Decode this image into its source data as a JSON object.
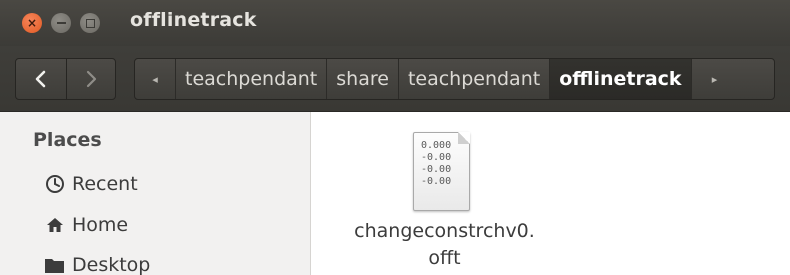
{
  "window": {
    "title": "offlinetrack"
  },
  "toolbar": {
    "back_icon": "chevron-left-icon",
    "forward_icon": "chevron-right-icon",
    "path_left_icon": "path-scroll-left-icon",
    "path_right_icon": "path-scroll-right-icon",
    "breadcrumbs": [
      "teachpendant",
      "share",
      "teachpendant",
      "offlinetrack"
    ]
  },
  "sidebar": {
    "heading": "Places",
    "items": [
      {
        "label": "Recent",
        "icon": "clock-icon"
      },
      {
        "label": "Home",
        "icon": "home-icon"
      },
      {
        "label": "Desktop",
        "icon": "folder-icon"
      }
    ]
  },
  "files": [
    {
      "name": "changeconstrchv0.\nofft",
      "icon": "text-file-icon",
      "preview_lines": [
        "0.000",
        "-0.00",
        "-0.00",
        "-0.00"
      ]
    }
  ],
  "colors": {
    "titlebar": "#3c3b37",
    "close_button": "#e05a23",
    "sidebar_bg": "#f2f1f0"
  }
}
